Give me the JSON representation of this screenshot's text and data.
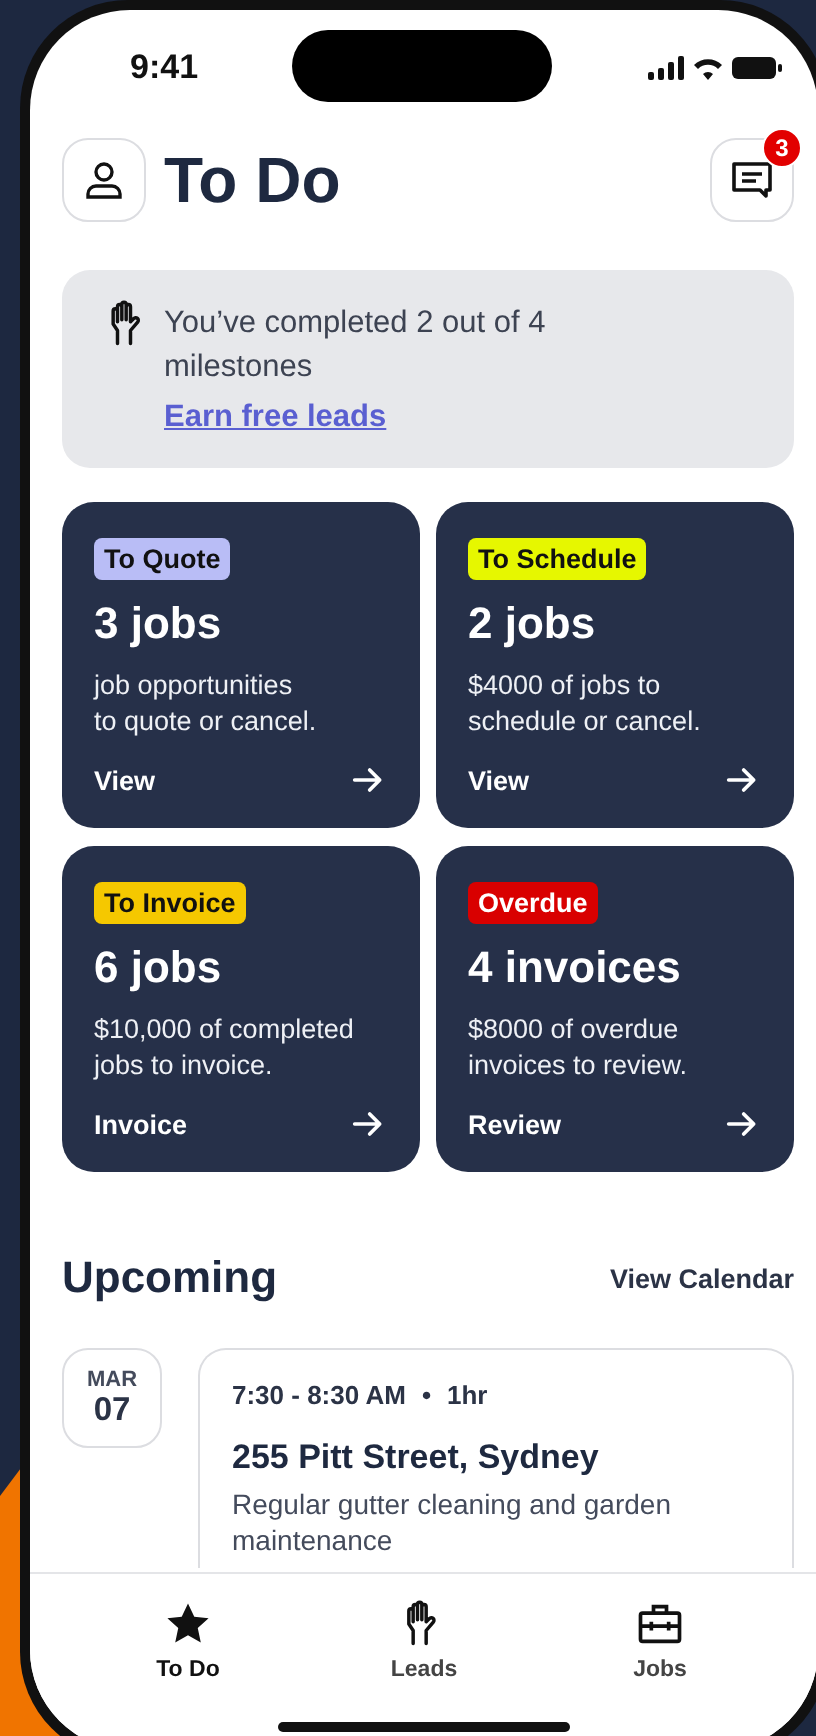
{
  "status_bar": {
    "time": "9:41"
  },
  "header": {
    "title": "To Do",
    "notification_count": "3"
  },
  "milestone": {
    "text": "You’ve completed 2 out of 4 milestones",
    "link": "Earn free leads"
  },
  "cards": [
    {
      "tag": "To Quote",
      "color": "#b9bdf6",
      "count": "3 jobs",
      "description": "job opportunities\nto quote or cancel.",
      "action": "View"
    },
    {
      "tag": "To Schedule",
      "color": "#e6f700",
      "count": "2 jobs",
      "description": "$4000 of jobs to\nschedule or cancel.",
      "action": "View"
    },
    {
      "tag": "To Invoice",
      "color": "#f5c800",
      "count": "6 jobs",
      "description": "$10,000 of completed\njobs to invoice.",
      "action": "Invoice"
    },
    {
      "tag": "Overdue",
      "color": "#d90000",
      "count": "4 invoices",
      "description": "$8000 of overdue\ninvoices to review.",
      "action": "Review"
    }
  ],
  "upcoming": {
    "title": "Upcoming",
    "link": "View Calendar",
    "events": [
      {
        "month": "MAR",
        "day": "07",
        "time": "7:30 - 8:30 AM",
        "separator": "•",
        "duration": "1hr",
        "address": "255 Pitt Street, Sydney",
        "description": "Regular gutter cleaning and garden maintenance"
      }
    ]
  },
  "tabs": [
    {
      "label": "To Do",
      "kind": "star",
      "selected": true
    },
    {
      "label": "Leads",
      "kind": "hand",
      "selected": false
    },
    {
      "label": "Jobs",
      "kind": "briefcase",
      "selected": false
    }
  ]
}
